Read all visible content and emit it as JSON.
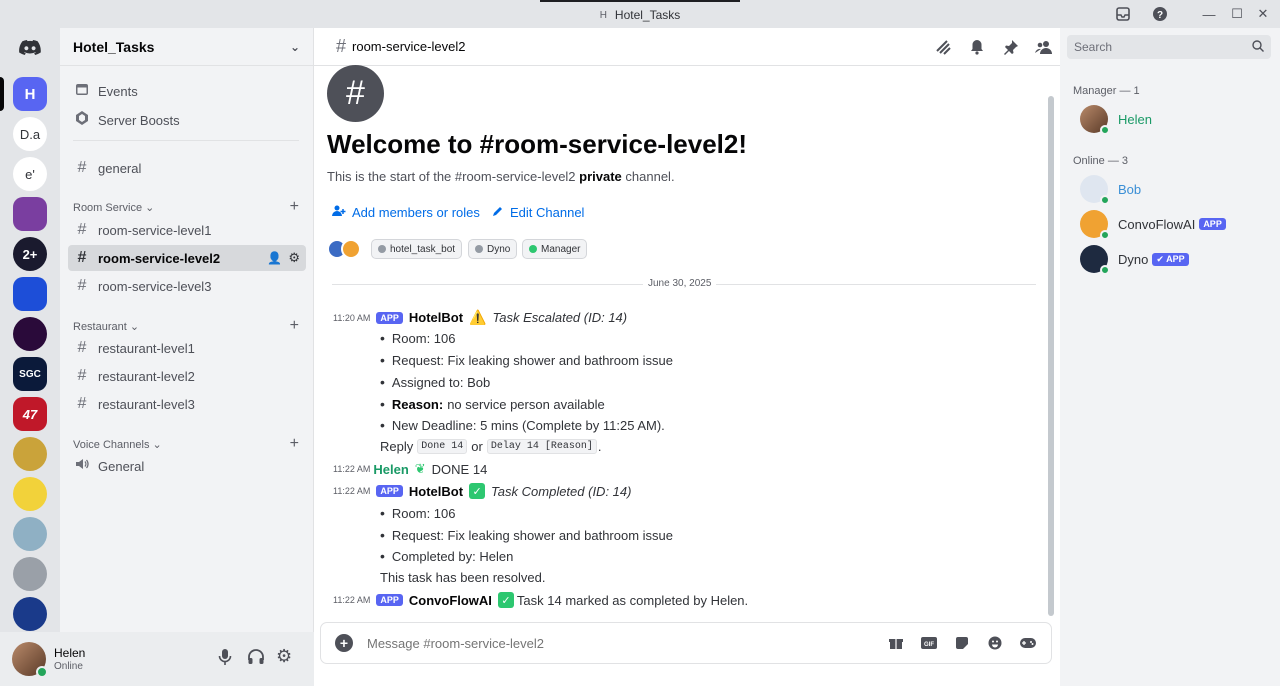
{
  "window": {
    "title": "Hotel_Tasks",
    "title_badge": "H"
  },
  "rail": {
    "active": "H",
    "servers": [
      "D.a",
      "e'"
    ],
    "server_colors": [
      "#7a3ea0",
      "#1a1a2e",
      "#1d4ed8",
      "#2a0a3a",
      "#0b1a3a",
      "#c01829",
      "#caa33a",
      "#f2d23a",
      "#8fb0c4",
      "#9aa0a8",
      "#1a3a8a"
    ],
    "server_art_labels": [
      "2+",
      "SGC",
      "47"
    ]
  },
  "sidebar": {
    "guild_name": "Hotel_Tasks",
    "top_items": [
      {
        "icon": "calendar-icon",
        "label": "Events"
      },
      {
        "icon": "boost-icon",
        "label": "Server Boosts"
      }
    ],
    "general_channel": "general",
    "categories": [
      {
        "name": "Room Service",
        "channels": [
          "room-service-level1",
          "room-service-level2",
          "room-service-level3"
        ]
      },
      {
        "name": "Restaurant",
        "channels": [
          "restaurant-level1",
          "restaurant-level2",
          "restaurant-level3"
        ]
      },
      {
        "name": "Voice Channels",
        "channels": [
          "General"
        ]
      }
    ],
    "selected_channel": "room-service-level2"
  },
  "user_panel": {
    "name": "Helen",
    "status": "Online"
  },
  "channel": {
    "name": "room-service-level2",
    "welcome_title": "Welcome to #room-service-level2!",
    "welcome_sub_pre": "This is the start of the #room-service-level2 ",
    "welcome_sub_bold": "private",
    "welcome_sub_post": " channel.",
    "add_members": "Add members or roles",
    "edit_channel": "Edit Channel",
    "roles": [
      {
        "label": "hotel_task_bot",
        "color": "#949ba4"
      },
      {
        "label": "Dyno",
        "color": "#949ba4"
      },
      {
        "label": "Manager",
        "color": "#2dc770"
      }
    ],
    "date_divider": "June 30, 2025"
  },
  "search": {
    "placeholder": "Search"
  },
  "messages": {
    "m1": {
      "time": "11:20 AM",
      "tag": "APP",
      "author": "HotelBot",
      "title": "Task Escalated (ID: 14)",
      "room": "Room: 106",
      "request": "Request: Fix leaking shower and bathroom issue",
      "assigned": "Assigned to: Bob",
      "reason_label": "Reason:",
      "reason_value": "no service person available",
      "deadline": "New Deadline: 5 mins (Complete by 11:25 AM).",
      "reply_pre": "Reply",
      "code1": "Done 14",
      "reply_or": "or",
      "code2": "Delay 14 [Reason]",
      "reply_post": "."
    },
    "m2": {
      "time": "11:22 AM",
      "author": "Helen",
      "text": "DONE 14"
    },
    "m3": {
      "time": "11:22 AM",
      "tag": "APP",
      "author": "HotelBot",
      "title": "Task Completed (ID: 14)",
      "room": "Room: 106",
      "request": "Request: Fix leaking shower and bathroom issue",
      "completed": "Completed by: Helen",
      "resolved": "This task has been resolved."
    },
    "m4": {
      "time": "11:22 AM",
      "tag": "APP",
      "author": "ConvoFlowAI",
      "text": "Task 14 marked as completed by Helen."
    }
  },
  "composer": {
    "placeholder": "Message #room-service-level2"
  },
  "members": {
    "manager_header": "Manager — 1",
    "online_header": "Online — 3",
    "manager": [
      {
        "name": "Helen",
        "color": "#1a9a66"
      }
    ],
    "online": [
      {
        "name": "Bob",
        "color": "#3b8fd6",
        "tag": ""
      },
      {
        "name": "ConvoFlowAI",
        "color": "#313338",
        "tag": "APP"
      },
      {
        "name": "Dyno",
        "color": "#313338",
        "tag": "✔ APP"
      }
    ]
  },
  "colors": {
    "accent": "#5865f2",
    "link": "#006ce7",
    "online": "#23a55a"
  }
}
